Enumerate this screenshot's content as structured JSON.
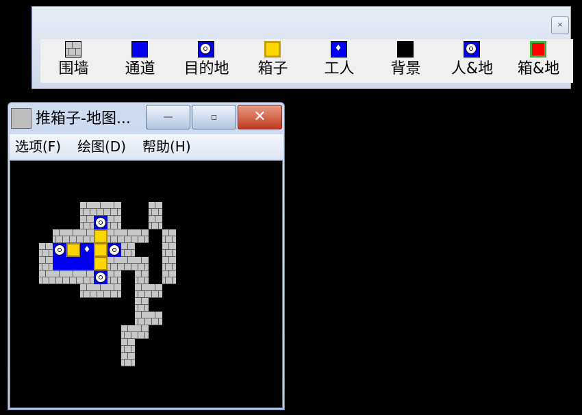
{
  "palette": {
    "close_label": "×",
    "tools": [
      {
        "label": "围墙",
        "icon": "wall-icon",
        "color": "#c8c8c8"
      },
      {
        "label": "通道",
        "icon": "floor-icon",
        "color": "#0000ee"
      },
      {
        "label": "目的地",
        "icon": "goal-icon",
        "color": "#0000ee"
      },
      {
        "label": "箱子",
        "icon": "box-icon",
        "color": "#ffd700"
      },
      {
        "label": "工人",
        "icon": "worker-icon",
        "color": "#0000ee"
      },
      {
        "label": "背景",
        "icon": "background-icon",
        "color": "#000000"
      },
      {
        "label": "人&地",
        "icon": "worker-on-goal-icon",
        "color": "#0000ee"
      },
      {
        "label": "箱&地",
        "icon": "box-on-goal-icon",
        "color": "#ff0000"
      }
    ]
  },
  "window": {
    "title": "推箱子-地图...",
    "min_label": "—",
    "max_label": "▫",
    "close_label": "✕",
    "menu": [
      "选项(F)",
      "绘图(D)",
      "帮助(H)"
    ]
  },
  "map": {
    "cell_size_label": "20",
    "legend": {
      "#": "wall",
      "_": "floor",
      "B": "box",
      "G": "goal",
      "M": "worker",
      ".": "background"
    },
    "rows": [
      "..........................................",
      "..........................................",
      "..........................................",
      ".....###..#",
      ".....#G#..#",
      "...###B###.#",
      "..#GBMBG#..#",
      "..#___B###.#",
      "..####G#.#.#",
      ".....###.##.",
      ".........#..",
      ".........##.",
      "........##..",
      "........#...",
      "........#..."
    ]
  }
}
